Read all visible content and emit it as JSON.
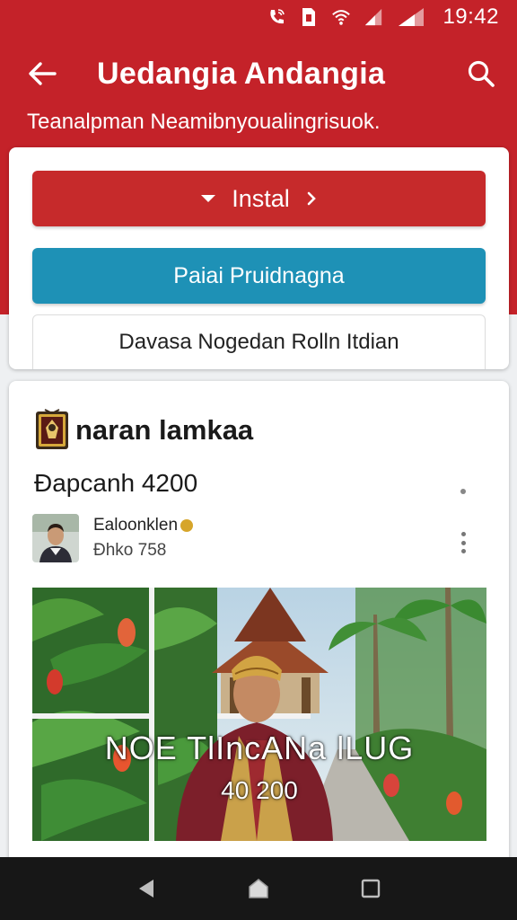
{
  "status_bar": {
    "time": "19:42",
    "icons": [
      "phone-wifi-icon",
      "sim-icon",
      "wifi-icon",
      "signal-icon",
      "signal-icon"
    ]
  },
  "app_bar": {
    "title": "Uedangia Andangia",
    "back_icon": "arrow-left-icon",
    "search_icon": "search-icon"
  },
  "subtitle": "Teanalpman Neamibnyoualingrisuok.",
  "actions": {
    "install_label": "Instal",
    "secondary_label": "Paiai Pruidnagna",
    "outline_label": "Davasa Nogedan Rolln Itdian"
  },
  "post": {
    "title": "naran lamkaa",
    "subtitle": "Đapcanh 4200",
    "author_name": "Ealoonklen",
    "author_meta": "Đhko 758",
    "image_caption": "NOE TlIncANa lLUG",
    "image_caption_sub": "40 200"
  },
  "nav": {
    "back_icon": "nav-back-icon",
    "home_icon": "nav-home-icon",
    "recents_icon": "nav-recents-icon"
  },
  "colors": {
    "primary_red": "#c42229",
    "button_red": "#c62a2b",
    "button_teal": "#1e91b6",
    "nav_bar": "#171717"
  }
}
